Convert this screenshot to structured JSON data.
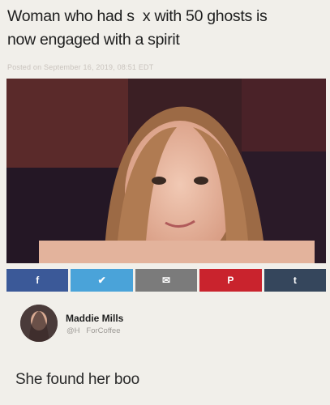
{
  "article": {
    "headline_line1": "Woman who had s  x with 50 ghosts is",
    "headline_line2": "now engaged with a spirit",
    "posted": "Posted on September 16, 2019, 08:51 EDT"
  },
  "share": [
    {
      "label": "f",
      "icon": "facebook-icon",
      "color": "#3b5998"
    },
    {
      "label": "✔",
      "icon": "twitter-icon",
      "color": "#4aa3d9"
    },
    {
      "label": "✉",
      "icon": "email-icon",
      "color": "#7b7b7b"
    },
    {
      "label": "P",
      "icon": "pinterest-icon",
      "color": "#c9232d"
    },
    {
      "label": "t",
      "icon": "tumblr-icon",
      "color": "#35465c"
    }
  ],
  "tweet": {
    "name": "Maddie Mills",
    "handle": "@H   ForCoffee",
    "text": "She found her boo"
  }
}
